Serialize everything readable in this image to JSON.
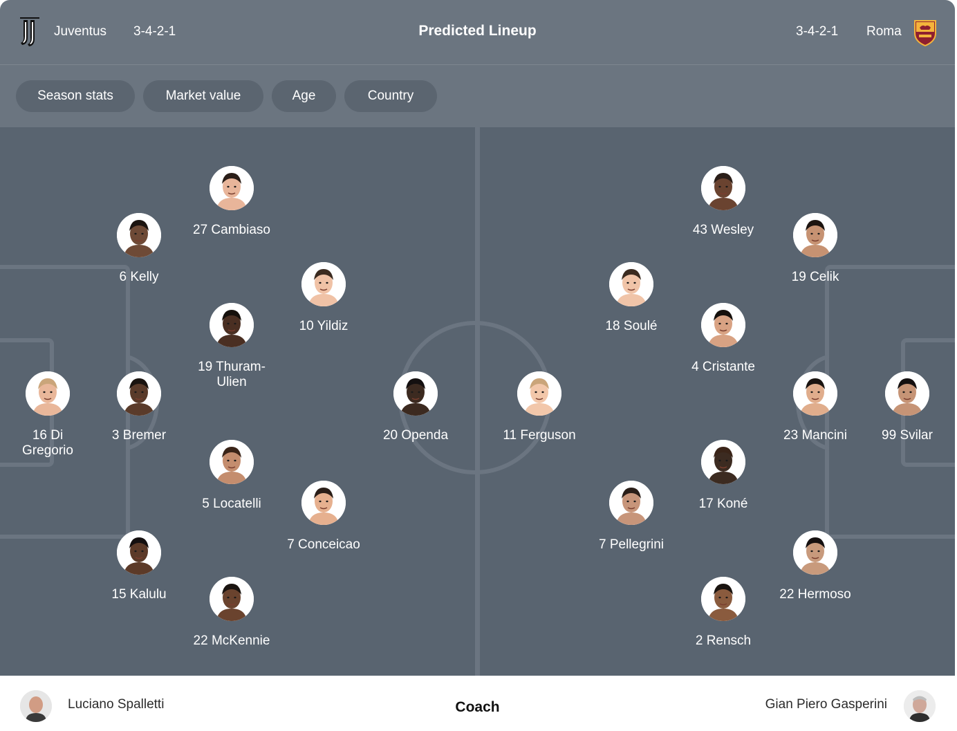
{
  "header": {
    "title": "Predicted Lineup",
    "home": {
      "name": "Juventus",
      "formation": "3-4-2-1",
      "logo_icon": "juventus-logo-icon"
    },
    "away": {
      "name": "Roma",
      "formation": "3-4-2-1",
      "logo_icon": "roma-crest-icon"
    }
  },
  "filters": [
    "Season stats",
    "Market value",
    "Age",
    "Country"
  ],
  "colors": {
    "header_bg": "#6b7580",
    "pill_bg": "#5b6570",
    "pitch_bg": "#596470",
    "pitch_lines": "#6b7581",
    "text_light": "#ffffff",
    "roma_red": "#8e1f2f",
    "roma_gold": "#f4b43b"
  },
  "home_players": [
    {
      "number": "27",
      "name": "Cambiaso",
      "label": "27 Cambiaso"
    },
    {
      "number": "6",
      "name": "Kelly",
      "label": "6 Kelly"
    },
    {
      "number": "10",
      "name": "Yildiz",
      "label": "10 Yildiz"
    },
    {
      "number": "19",
      "name": "Thuram-Ulien",
      "label": "19 Thuram-\nUlien"
    },
    {
      "number": "16",
      "name": "Di Gregorio",
      "label": "16 Di\nGregorio"
    },
    {
      "number": "3",
      "name": "Bremer",
      "label": "3 Bremer"
    },
    {
      "number": "20",
      "name": "Openda",
      "label": "20 Openda"
    },
    {
      "number": "5",
      "name": "Locatelli",
      "label": "5 Locatelli"
    },
    {
      "number": "7",
      "name": "Conceicao",
      "label": "7 Conceicao"
    },
    {
      "number": "15",
      "name": "Kalulu",
      "label": "15 Kalulu"
    },
    {
      "number": "22",
      "name": "McKennie",
      "label": "22 McKennie"
    }
  ],
  "away_players": [
    {
      "number": "43",
      "name": "Wesley",
      "label": "43 Wesley"
    },
    {
      "number": "19",
      "name": "Celik",
      "label": "19 Celik"
    },
    {
      "number": "18",
      "name": "Soulé",
      "label": "18 Soulé"
    },
    {
      "number": "4",
      "name": "Cristante",
      "label": "4 Cristante"
    },
    {
      "number": "11",
      "name": "Ferguson",
      "label": "11 Ferguson"
    },
    {
      "number": "23",
      "name": "Mancini",
      "label": "23 Mancini"
    },
    {
      "number": "99",
      "name": "Svilar",
      "label": "99 Svilar"
    },
    {
      "number": "17",
      "name": "Koné",
      "label": "17 Koné"
    },
    {
      "number": "7",
      "name": "Pellegrini",
      "label": "7 Pellegrini"
    },
    {
      "number": "22",
      "name": "Hermoso",
      "label": "22 Hermoso"
    },
    {
      "number": "2",
      "name": "Rensch",
      "label": "2 Rensch"
    }
  ],
  "footer": {
    "label": "Coach",
    "home_coach": "Luciano Spalletti",
    "away_coach": "Gian Piero Gasperini"
  }
}
